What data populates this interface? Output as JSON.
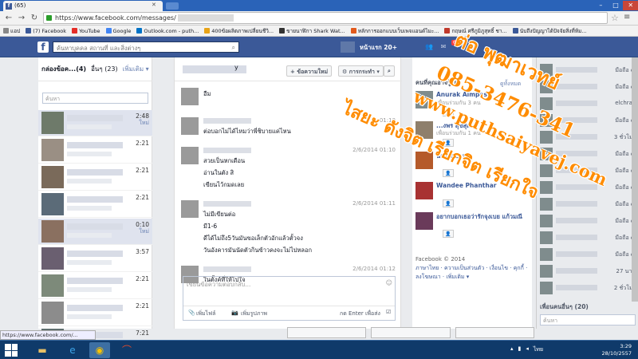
{
  "browser": {
    "tab_title": "(65)",
    "url": "https://www.facebook.com/messages/",
    "bookmarks": [
      {
        "label": "แอป",
        "color": "#888888"
      },
      {
        "label": "(7) Facebook",
        "color": "#3b5998"
      },
      {
        "label": "YouTube",
        "color": "#e52d27"
      },
      {
        "label": "Google",
        "color": "#4285f4"
      },
      {
        "label": "Outlook.com - puth...",
        "color": "#0072c6"
      },
      {
        "label": "400ข้อผลิตภาพเปลี่ยนชีวิ...",
        "color": "#e8a317"
      },
      {
        "label": "ขายนาฬิกา Shark Wat...",
        "color": "#333333"
      },
      {
        "label": "หลักการออกแบบเว็บเพจแอนด์ไมะ...",
        "color": "#e25a1c"
      },
      {
        "label": "กฤษณ์ ศรีภูมิภูสุทธิ์ ชา...",
        "color": "#c0392b"
      },
      {
        "label": "นับถึงปัญญาได้ปัจจัยสิ่งที่ห้ม...",
        "color": "#3b5998"
      }
    ]
  },
  "fb": {
    "logo": "f",
    "search_placeholder": "ค้นหาบุคคล สถานที่ และสิ่งต่างๆ",
    "home_label": "หน้าแรก 20+",
    "notif_count": "61"
  },
  "left": {
    "tab_inbox": "กล่องข้อค...(4)",
    "tab_other": "อื่นๆ (23)",
    "tab_more": "เพิ่มเติม ▾",
    "search_placeholder": "ค้นหา",
    "conversations": [
      {
        "time": "2:48",
        "sub": "ใหม่"
      },
      {
        "time": "2:21",
        "sub": ""
      },
      {
        "time": "2:21",
        "sub": ""
      },
      {
        "time": "2:21",
        "sub": ""
      },
      {
        "time": "0:10",
        "sub": "ใหม่"
      },
      {
        "time": "3:57",
        "sub": ""
      },
      {
        "time": "2:21",
        "sub": ""
      },
      {
        "time": "2:21",
        "sub": ""
      },
      {
        "time": "7:21",
        "sub": ""
      }
    ]
  },
  "middle": {
    "header_suffix": "y",
    "new_message_btn": "+ ข้อความใหม่",
    "actions_btn": "⚙ การกระทำ ▾",
    "search_btn": "⌕",
    "messages": [
      {
        "time": "",
        "lines": [
          "อืม"
        ]
      },
      {
        "time": "01:10",
        "lines": [
          "ต่อบอกไม่ได้ไหมว่าพี่ชิบายแค่ไหน"
        ]
      },
      {
        "time": "2/6/2014 01:10",
        "lines": [
          "สวยเป็นหกเดือน",
          "อ่านในตัง สิ",
          "เขียนไว้กมดเลย"
        ]
      },
      {
        "time": "2/6/2014 01:11",
        "lines": [
          "ไม่มีเขียนต่อ",
          "มี1-6",
          "ดีได้ไม่ถึง5วันมันขอเล็กตัวอักแล้วตั้วจง",
          "วันอังคารมันนัดตัวกินข้าวคงจะไม่ไปหลอก"
        ]
      },
      {
        "time": "2/6/2014 01:12",
        "lines": [
          "ในตั้งค์ที่ให้ไปใจ"
        ]
      }
    ],
    "reply_placeholder": "เขียนข้อความตอบกลับ...",
    "add_file": "เพิ่มไฟล์",
    "add_photo": "เพิ่มรูปภาพ",
    "enter_to_send": "กด Enter เพื่อส่ง"
  },
  "right": {
    "header": "คนที่คุณอาจรู้จัก",
    "hide": "ดูทั้งหมด",
    "suggestions": [
      {
        "name": "Anurak Aimpase",
        "sub": "เพื่อนร่วมกัน 3 คน",
        "color": "#7f8c8d"
      },
      {
        "name": "...งพร สุขสุด",
        "sub": "เพื่อนร่วมกัน 1 คน",
        "color": "#8e7f6c"
      },
      {
        "name": "น้องผึ้ง บ้าน",
        "sub": "",
        "color": "#b55a2a"
      },
      {
        "name": "Wandee Phanthar",
        "sub": "",
        "color": "#a83232"
      },
      {
        "name": "อยากบอกเธอว่ารักจุงเบย แก้วมณี",
        "sub": "",
        "color": "#6a3a5a"
      }
    ],
    "footer_copyright": "Facebook © 2014",
    "footer_links": "ภาษาไทย · ความเป็นส่วนตัว · เงื่อนไข · คุกกี้ · ลงโฆษณา · เพิ่มเติม ▾"
  },
  "chat": {
    "friends": [
      {
        "status": "มือถือ ●"
      },
      {
        "status": "มือถือ ●"
      },
      {
        "status": "elchrak"
      },
      {
        "status": "มือถือ ●"
      },
      {
        "status": "3 ชั่วโมง"
      },
      {
        "status": "มือถือ ●"
      },
      {
        "status": "มือถือ ●"
      },
      {
        "status": "มือถือ ●"
      },
      {
        "status": "มือถือ ●"
      },
      {
        "status": "มือถือ ●"
      },
      {
        "status": "มือถือ ●"
      },
      {
        "status": "มือถือ ●"
      },
      {
        "status": "27 นาที"
      },
      {
        "status": "2 ชั่วโมง"
      }
    ],
    "more_friends": "เพื่อนคนอื่นๆ (20)",
    "search_placeholder": "ค้นหา"
  },
  "status_url": "https://www.facebook.com/...",
  "taskbar": {
    "lang": "ไทย",
    "time": "3:29",
    "date": "28/10/2557"
  },
  "watermark": {
    "line1": "ต่อ พุฒาเวทย์",
    "line2": "085-3476-341",
    "line3": "www.puthsaiyavej.com",
    "line4": "ไสยะ ดังจิต เรียกจิต เรียกใจ"
  }
}
